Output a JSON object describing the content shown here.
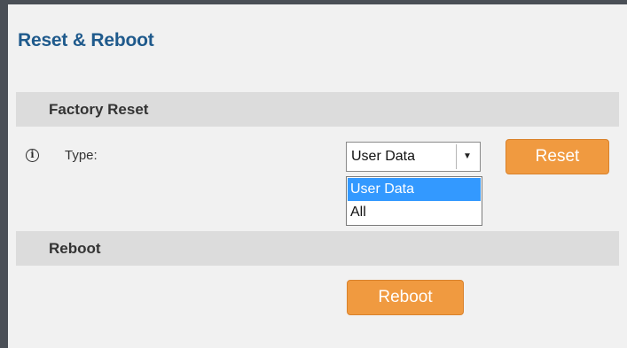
{
  "page": {
    "title": "Reset & Reboot"
  },
  "factory_reset": {
    "header": "Factory Reset",
    "info_icon": "info-icon",
    "type_label": "Type:",
    "select": {
      "value": "User Data",
      "arrow": "▼",
      "options": [
        "User Data",
        "All"
      ]
    },
    "reset_button": "Reset"
  },
  "reboot": {
    "header": "Reboot",
    "reboot_button": "Reboot"
  },
  "colors": {
    "title": "#1f5a8c",
    "button": "#f09a40",
    "section_header_bg": "#dcdcdc",
    "dropdown_highlight": "#3399ff",
    "frame": "#4a4f56"
  }
}
